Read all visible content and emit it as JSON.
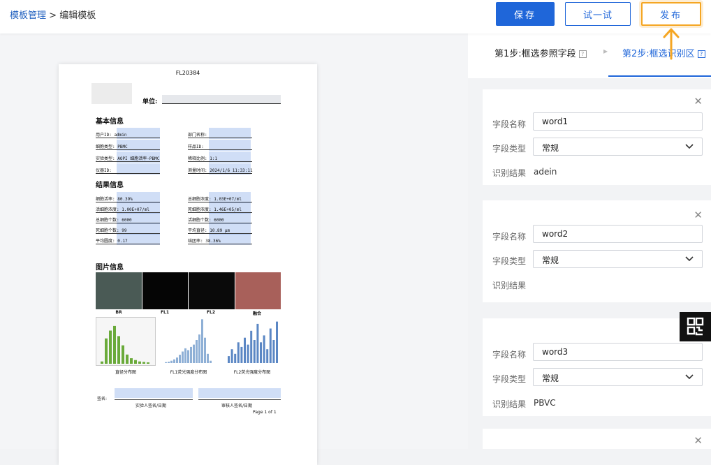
{
  "breadcrumb": {
    "parent": "模板管理",
    "separator": ">",
    "current": "编辑模板"
  },
  "toolbar": {
    "save_label": "保存",
    "try_label": "试一试",
    "publish_label": "发布"
  },
  "doc": {
    "code": "FL20384",
    "unit_label": "单位:",
    "section_basic": "基本信息",
    "section_result": "结果信息",
    "section_images": "图片信息",
    "basic_fields": [
      {
        "left": "用户ID: admin",
        "right": "部门名称:"
      },
      {
        "left": "细胞类型: PBMC",
        "right": "样品ID:"
      },
      {
        "left": "实验类型: AOPI 细胞活率-PBMC",
        "right": "稀释比例: 1:1"
      },
      {
        "left": "仪器ID:",
        "right": "测量时间: 2024/1/6 11:33:11"
      }
    ],
    "result_fields": [
      {
        "left": "细胞活率: 80.39%",
        "right": "总细胞浓度: 1.03E+07/ml"
      },
      {
        "left": "活细胞浓度: 1.00E+07/ml",
        "right": "死细胞浓度: 1.46E+05/ml"
      },
      {
        "left": "总细胞个数: 6000",
        "right": "活细胞个数: 6000"
      },
      {
        "left": "死细胞个数: 99",
        "right": "平均直径: 10.89 μm"
      },
      {
        "left": "平均圆度: 0.17",
        "right": "结团率: 38.36%"
      }
    ],
    "image_labels": [
      "BR",
      "FL1",
      "FL2",
      "融合"
    ],
    "chart_labels": [
      "直径分布图",
      "FL1荧光强度分布图",
      "FL2荧光强度分布图"
    ],
    "sign_label": "签名:",
    "sign_left": "实验人签名/日期",
    "sign_right": "审核人签名/日期",
    "page": "Page 1 of 1"
  },
  "steps": {
    "step1": "第1步:框选参照字段",
    "step2": "第2步:框选识别区",
    "sep": "▸",
    "help": "?"
  },
  "labels": {
    "name": "字段名称",
    "type": "字段类型",
    "result": "识别结果"
  },
  "cards": [
    {
      "name": "word1",
      "type": "常规",
      "result": "adein"
    },
    {
      "name": "word2",
      "type": "常规",
      "result": ""
    },
    {
      "name": "word3",
      "type": "常规",
      "result": "PBVC"
    }
  ],
  "colors": {
    "primary": "#1f66d9",
    "highlight": "#f5a623"
  }
}
